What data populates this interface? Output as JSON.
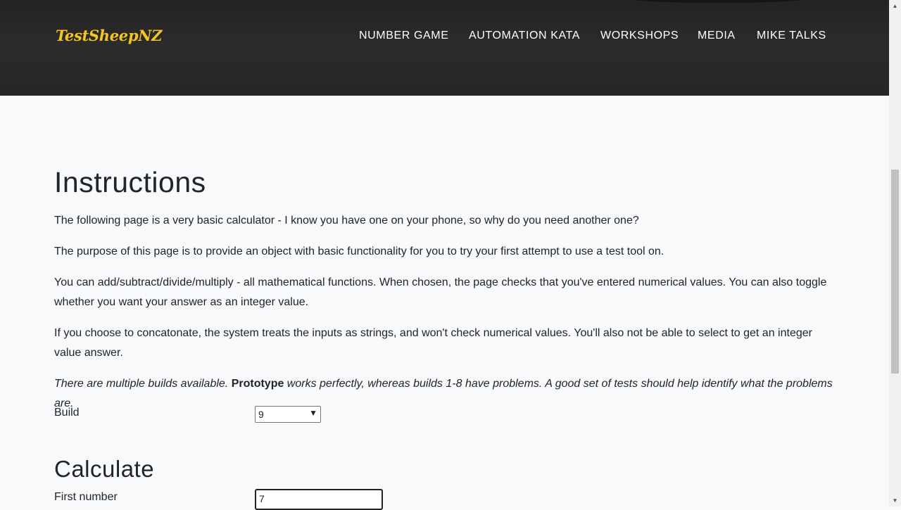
{
  "header": {
    "logo": "TestSheepNZ",
    "nav": [
      "NUMBER GAME",
      "AUTOMATION KATA",
      "WORKSHOPS",
      "MEDIA",
      "MIKE TALKS"
    ]
  },
  "instructions": {
    "title": "Instructions",
    "p1": "The following page is a very basic calculator - I know you have one on your phone, so why do you need another one?",
    "p2": "The purpose of this page is to provide an object with basic functionality for you to try your first attempt to use a test tool on.",
    "p3a": "You can add/subtract/divide/multiply - all mathematical functions. When chosen, the page checks that you've entered numerical values. You can also toggle",
    "p3b": "whether you want your answer as an integer value.",
    "p4a": "If you choose to concatonate, the system treats the inputs as strings, and won't check numerical values. You'll also not be able to select to get an integer",
    "p4b": "value answer.",
    "p5_pre": "There are multiple builds available. ",
    "p5_bold": "Prototype",
    "p5_post": " works perfectly, whereas builds 1-8 have problems. A good set of tests should help identify what the problems are."
  },
  "build": {
    "label": "Build",
    "selected": "9"
  },
  "calculate": {
    "title": "Calculate",
    "first_label": "First number",
    "first_value": "7"
  },
  "colors": {
    "header_bg": "#262626",
    "logo": "#f3c623",
    "page_bg": "#f7f9fb"
  }
}
